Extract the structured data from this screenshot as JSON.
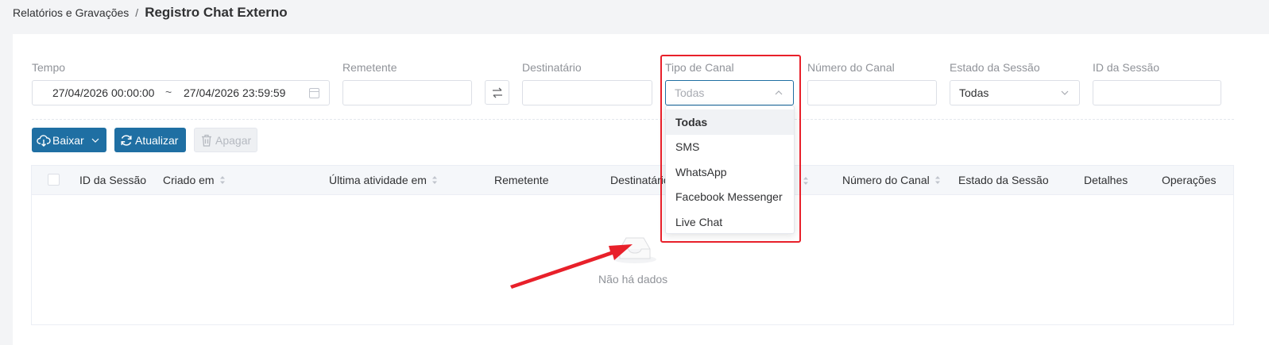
{
  "breadcrumb": {
    "parent": "Relatórios e Gravações",
    "separator": "/",
    "current": "Registro Chat Externo"
  },
  "filters": {
    "time": {
      "label": "Tempo",
      "start": "27/04/2026 00:00:00",
      "separator": "~",
      "end": "27/04/2026 23:59:59"
    },
    "sender": {
      "label": "Remetente",
      "value": ""
    },
    "swap_icon": "swap-arrows-icon",
    "recipient": {
      "label": "Destinatário",
      "value": ""
    },
    "channel_type": {
      "label": "Tipo de Canal",
      "placeholder": "Todas"
    },
    "channel_number": {
      "label": "Número do Canal",
      "value": ""
    },
    "session_state": {
      "label": "Estado da Sessão",
      "value": "Todas"
    },
    "session_id": {
      "label": "ID da Sessão",
      "value": ""
    }
  },
  "toolbar": {
    "download_label": "Baixar",
    "refresh_label": "Atualizar",
    "delete_label": "Apagar"
  },
  "table": {
    "columns": {
      "session_id": "ID da Sessão",
      "created_at": "Criado em",
      "last_activity": "Última atividade em",
      "sender": "Remetente",
      "recipient": "Destinatário",
      "channel_number": "Número do Canal",
      "session_state": "Estado da Sessão",
      "details": "Detalhes",
      "operations": "Operações"
    },
    "empty_text": "Não há dados"
  },
  "dropdown": {
    "options": [
      "Todas",
      "SMS",
      "WhatsApp",
      "Facebook Messenger",
      "Live Chat"
    ],
    "selected_index": 0
  },
  "colors": {
    "primary": "#1f6fa3",
    "highlight": "#e8202a",
    "select_focus": "#1f6fa3"
  }
}
